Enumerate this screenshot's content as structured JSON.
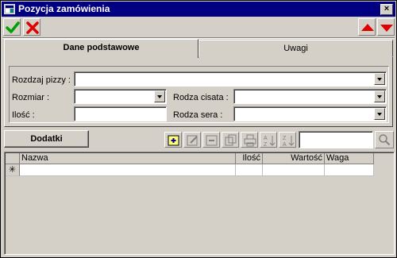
{
  "window": {
    "title": "Pozycja zamówienia",
    "close_glyph": "×"
  },
  "toolbar": {
    "accept_icon": "checkmark-icon",
    "cancel_icon": "x-cross-icon",
    "prev_icon": "arrow-up-icon",
    "next_icon": "arrow-down-icon",
    "accept_color": "#00a000",
    "cancel_color": "#e00000"
  },
  "tabs": [
    {
      "label": "Dane podstawowe",
      "active": true
    },
    {
      "label": "Uwagi",
      "active": false
    }
  ],
  "form": {
    "rodzaj_pizzy": {
      "label": "Rozdzaj pizzy :",
      "value": ""
    },
    "rozmiar": {
      "label": "Rozmiar :",
      "value": ""
    },
    "ilosc": {
      "label": "Ilość :",
      "value": ""
    },
    "rodzaj_ciasta": {
      "label": "Rodza cisata :",
      "value": ""
    },
    "rodzaj_sera": {
      "label": "Rodza sera :",
      "value": ""
    }
  },
  "detail": {
    "dodatki_label": "Dodatki",
    "search_value": "",
    "icons": [
      "add-record-icon",
      "edit-record-icon",
      "delete-record-icon",
      "copy-record-icon",
      "print-icon",
      "sort-ascending-icon",
      "sort-descending-icon"
    ]
  },
  "grid": {
    "columns": [
      "Nazwa",
      "Ilość",
      "Wartość",
      "Waga"
    ],
    "new_row_marker": "✳"
  }
}
